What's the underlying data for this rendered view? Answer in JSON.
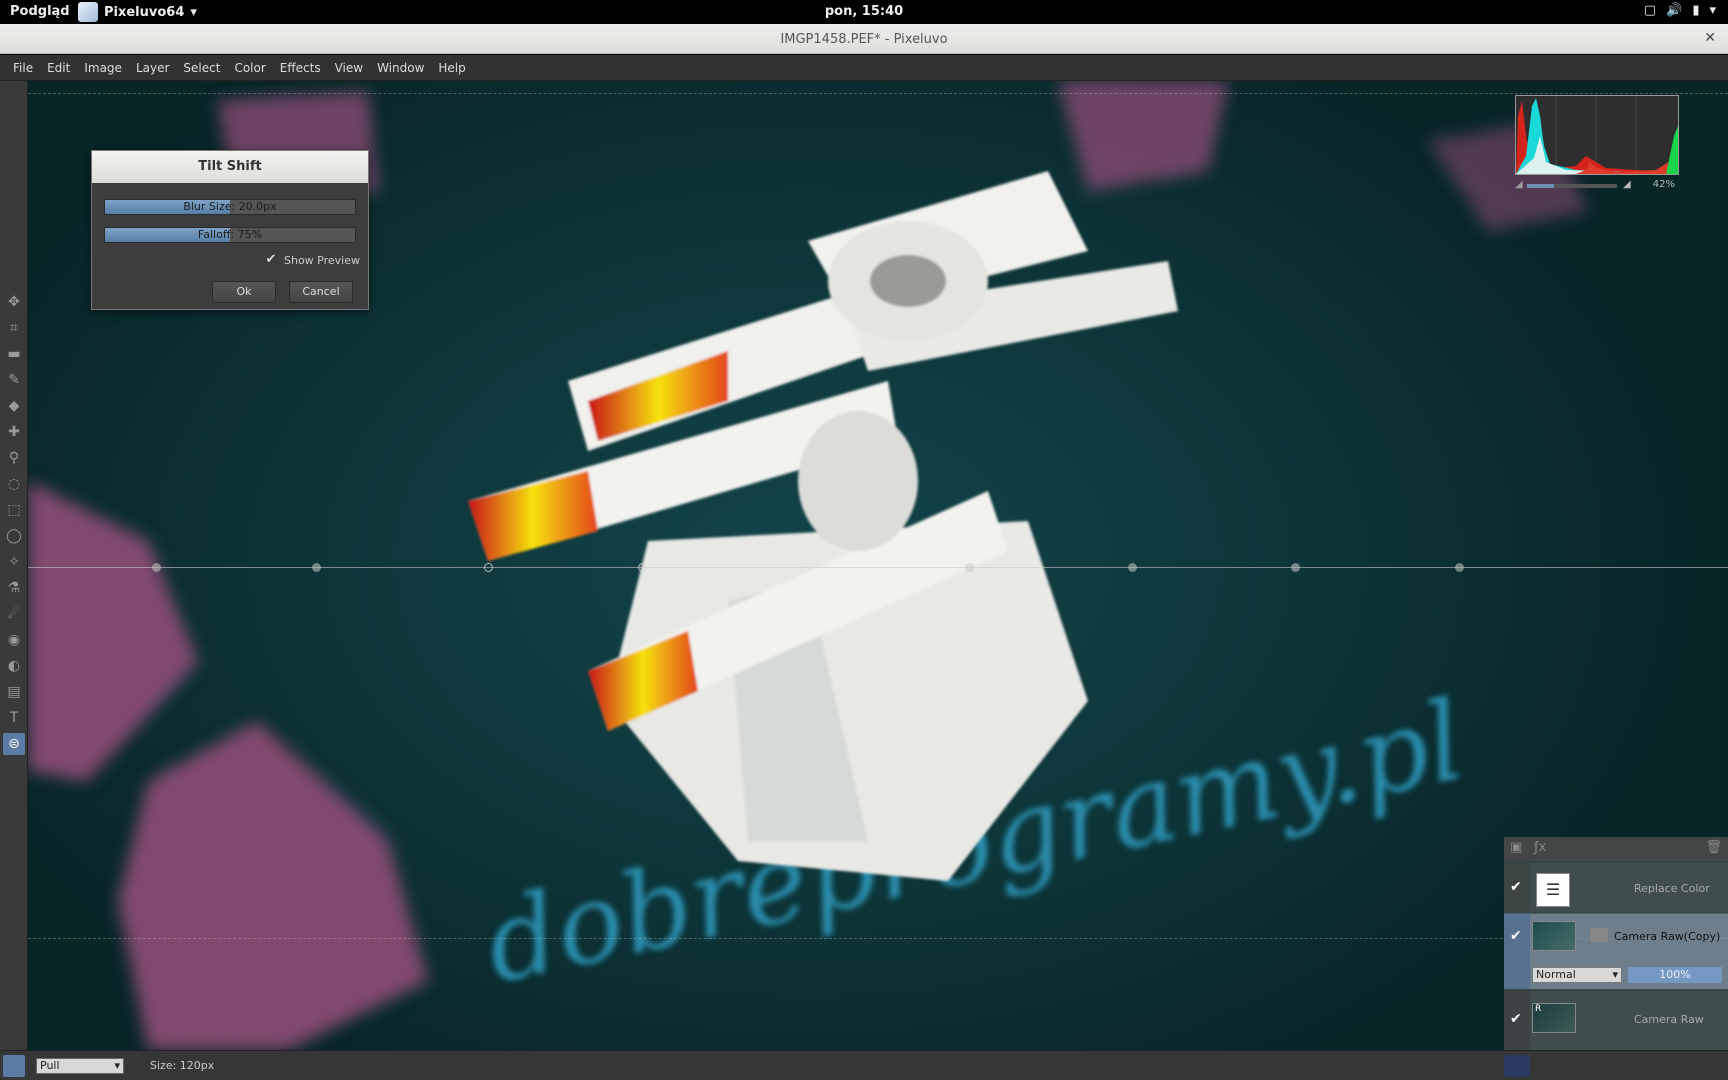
{
  "topbar": {
    "activities": "Podgląd",
    "app_menu": "Pixeluvo64",
    "clock": "pon, 15:40"
  },
  "window": {
    "title": "IMGP1458.PEF* - Pixeluvo"
  },
  "menu": [
    {
      "label": "File"
    },
    {
      "label": "Edit"
    },
    {
      "label": "Image"
    },
    {
      "label": "Layer"
    },
    {
      "label": "Select"
    },
    {
      "label": "Color"
    },
    {
      "label": "Effects"
    },
    {
      "label": "View"
    },
    {
      "label": "Window"
    },
    {
      "label": "Help"
    }
  ],
  "dialog": {
    "title": "Tilt Shift",
    "blur_label": "Blur Size: 20.0px",
    "blur_fraction": 0.5,
    "falloff_label": "Falloff: 75%",
    "falloff_fraction": 0.5,
    "show_preview_label": "Show Preview",
    "show_preview_checked": true,
    "ok_label": "Ok",
    "cancel_label": "Cancel"
  },
  "histogram": {
    "zoom_percent": "42%",
    "zoom_fraction": 0.3
  },
  "layers": {
    "rows": [
      {
        "name": "Replace Color",
        "visible": true
      },
      {
        "name": "Camera Raw(Copy)",
        "visible": true,
        "blend_mode": "Normal",
        "opacity": "100%"
      },
      {
        "name": "Camera Raw",
        "visible": true
      }
    ]
  },
  "statusbar": {
    "mode": "Pull",
    "size": "Size: 120px"
  },
  "canvas_text": "dobreprogramy.pl"
}
